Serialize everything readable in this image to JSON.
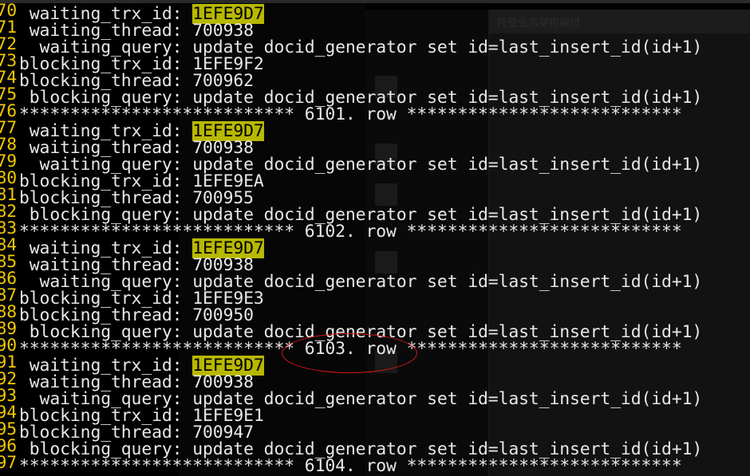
{
  "background_windows": {
    "chat_title": "托管业务架构探讨"
  },
  "terminal": {
    "lines": [
      {
        "ln": "70",
        "label": " waiting_trx_id: ",
        "value": "1EFE9D7",
        "highlight": true
      },
      {
        "ln": "71",
        "label": " waiting_thread: ",
        "value": "700938"
      },
      {
        "ln": "72",
        "label": "  waiting_query: ",
        "value": "update docid_generator set id=last_insert_id(id+1)"
      },
      {
        "ln": "73",
        "label": "blocking_trx_id: ",
        "value": "1EFE9F2"
      },
      {
        "ln": "74",
        "label": "blocking_thread: ",
        "value": "700962"
      },
      {
        "ln": "75",
        "label": " blocking_query: ",
        "value": "update docid_generator set id=last_insert_id(id+1)"
      },
      {
        "ln": "76",
        "label": "*************************** ",
        "value": "6101. row ***************************"
      },
      {
        "ln": "77",
        "label": " waiting_trx_id: ",
        "value": "1EFE9D7",
        "highlight": true
      },
      {
        "ln": "78",
        "label": " waiting_thread: ",
        "value": "700938"
      },
      {
        "ln": "79",
        "label": "  waiting_query: ",
        "value": "update docid_generator set id=last_insert_id(id+1)"
      },
      {
        "ln": "80",
        "label": "blocking_trx_id: ",
        "value": "1EFE9EA"
      },
      {
        "ln": "81",
        "label": "blocking_thread: ",
        "value": "700955"
      },
      {
        "ln": "82",
        "label": " blocking_query: ",
        "value": "update docid_generator set id=last_insert_id(id+1)"
      },
      {
        "ln": "83",
        "label": "*************************** ",
        "value": "6102. row ***************************"
      },
      {
        "ln": "84",
        "label": " waiting_trx_id: ",
        "value": "1EFE9D7",
        "highlight": true
      },
      {
        "ln": "85",
        "label": " waiting_thread: ",
        "value": "700938"
      },
      {
        "ln": "86",
        "label": "  waiting_query: ",
        "value": "update docid_generator set id=last_insert_id(id+1)"
      },
      {
        "ln": "87",
        "label": "blocking_trx_id: ",
        "value": "1EFE9E3"
      },
      {
        "ln": "88",
        "label": "blocking_thread: ",
        "value": "700950"
      },
      {
        "ln": "89",
        "label": " blocking_query: ",
        "value": "update docid_generator set id=last_insert_id(id+1)"
      },
      {
        "ln": "90",
        "label": "*************************** ",
        "value": "6103. row ***************************"
      },
      {
        "ln": "91",
        "label": " waiting_trx_id: ",
        "value": "1EFE9D7",
        "highlight": true
      },
      {
        "ln": "92",
        "label": " waiting_thread: ",
        "value": "700938"
      },
      {
        "ln": "93",
        "label": "  waiting_query: ",
        "value": "update docid_generator set id=last_insert_id(id+1)"
      },
      {
        "ln": "94",
        "label": "blocking_trx_id: ",
        "value": "1EFE9E1"
      },
      {
        "ln": "95",
        "label": "blocking_thread: ",
        "value": "700947"
      },
      {
        "ln": "96",
        "label": " blocking_query: ",
        "value": "update docid_generator set id=last_insert_id(id+1)"
      },
      {
        "ln": "97",
        "label": "*************************** ",
        "value": "6104. row ***************************"
      }
    ]
  },
  "colors": {
    "line_number": "#f0c800",
    "highlight_bg": "#b8b800",
    "annotation": "#d81818"
  }
}
